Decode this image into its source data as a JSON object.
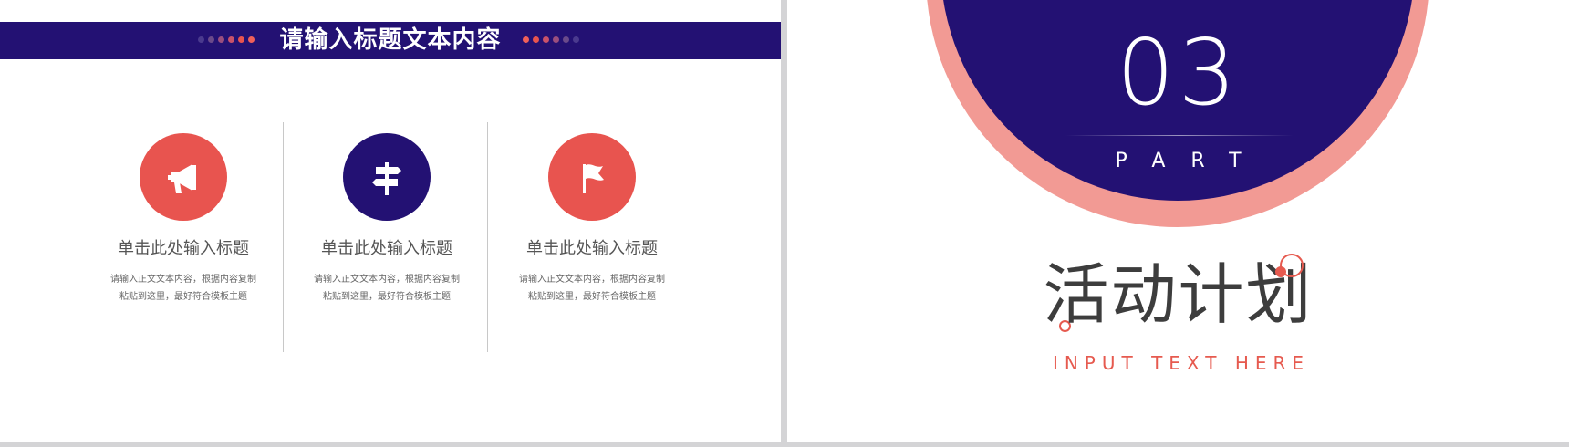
{
  "left_slide": {
    "title": "请输入标题文本内容",
    "cards": [
      {
        "icon": "megaphone-icon",
        "title": "单击此处输入标题",
        "body_line1": "请输入正文文本内容，根据内容复制",
        "body_line2": "粘贴到这里，最好符合模板主题",
        "color": "#e8544f"
      },
      {
        "icon": "signpost-icon",
        "title": "单击此处输入标题",
        "body_line1": "请输入正文文本内容，根据内容复制",
        "body_line2": "粘贴到这里，最好符合模板主题",
        "color": "#231173"
      },
      {
        "icon": "flag-icon",
        "title": "单击此处输入标题",
        "body_line1": "请输入正文文本内容，根据内容复制",
        "body_line2": "粘贴到这里，最好符合模板主题",
        "color": "#e8544f"
      }
    ]
  },
  "right_slide": {
    "part_number": "03",
    "part_label": "PART",
    "section_title": "活动计划",
    "section_subtitle": "INPUT TEXT HERE"
  },
  "colors": {
    "navy": "#231173",
    "coral": "#e8544f",
    "salmon": "#f29a94",
    "background": "#ffffff",
    "frame": "#d4d4d6"
  }
}
